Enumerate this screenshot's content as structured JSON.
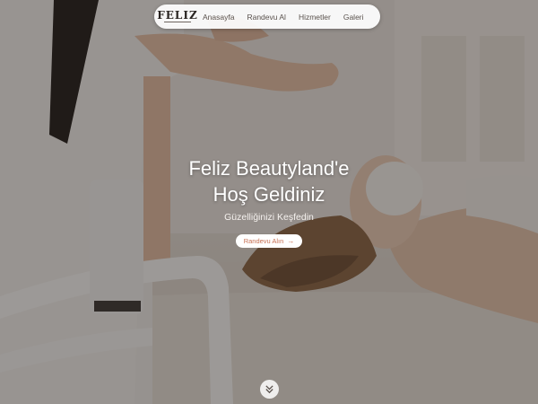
{
  "brand": {
    "logo_text": "FELIZ"
  },
  "nav": {
    "items": [
      {
        "label": "Anasayfa"
      },
      {
        "label": "Randevu Al"
      },
      {
        "label": "Hizmetler"
      },
      {
        "label": "Galeri"
      }
    ]
  },
  "hero": {
    "title_line1": "Feliz Beautyland'e",
    "title_line2": "Hoş Geldiniz",
    "subtitle": "Güzelliğinizi Keşfedin",
    "cta_label": "Randevu Alın",
    "cta_color": "#c66f52",
    "overlay_color": "#231c18"
  },
  "icons": {
    "cta_arrow": "arrow-right-icon",
    "scroll": "double-chevron-down-icon"
  }
}
